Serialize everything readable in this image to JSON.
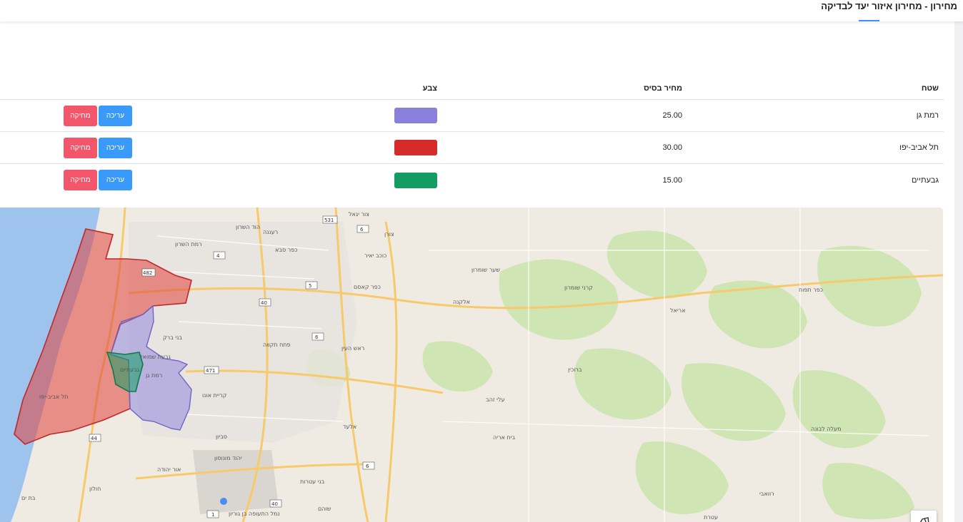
{
  "header": {
    "title": "מחירון - מחירון איזור יעד לבדיקה"
  },
  "table": {
    "columns": {
      "area": "שטח",
      "base_price": "מחיר בסיס",
      "color": "צבע"
    },
    "rows": [
      {
        "area": "רמת גן",
        "base_price": "25.00",
        "color": "#8980db",
        "edit_label": "עריכה",
        "delete_label": "מחיקה"
      },
      {
        "area": "תל אביב-יפו",
        "base_price": "30.00",
        "color": "#d62b2b",
        "edit_label": "עריכה",
        "delete_label": "מחיקה"
      },
      {
        "area": "גבעתיים",
        "base_price": "15.00",
        "color": "#139d62",
        "edit_label": "עריכה",
        "delete_label": "מחיקה"
      }
    ]
  },
  "map": {
    "labels": {
      "ramat_hasharon": "רמת השרון",
      "hod_hasharon": "הוד השרון",
      "kfar_saba": "כפר סבא",
      "raanana": "רעננה",
      "kochav_yair": "כוכב יאיר",
      "tzur_yigal": "צור יגאל",
      "tzoran": "צורן",
      "kfar_qasim": "כפר קאסם",
      "sha_ar_shomron": "שער שומרון",
      "elkana": "אלקנה",
      "karnei_shomron": "קרני שומרון",
      "ariel": "אריאל",
      "kfar_tapuach": "כפר תפוח",
      "rosh_haayin": "ראש העין",
      "petah_tikva": "פתח תקווה",
      "bnei_brak": "בני ברק",
      "givat_shmuel": "גבעת שמואל",
      "givatayim": "גבעתיים",
      "ramat_gan": "רמת גן",
      "tel_aviv": "תל אביב-יפו",
      "kiryat_ono": "קריית אונו",
      "savyon": "סביון",
      "yehud": "יהוד מונוסון",
      "or_yehuda": "אור יהודה",
      "holon": "חולון",
      "bat_yam": "בת ים",
      "elad": "אלעד",
      "shoham": "שוהם",
      "bnei_atarot": "בני עטרות",
      "bruchin": "ברוכין",
      "eli_zahav": "עלי זהב",
      "beit_aryeh": "בית אריה",
      "maale_levona": "מעלה לבונה",
      "rawabi": "רוואבי",
      "ateret": "עטרת",
      "airport": "נמל התעופה בן גוריון"
    }
  }
}
